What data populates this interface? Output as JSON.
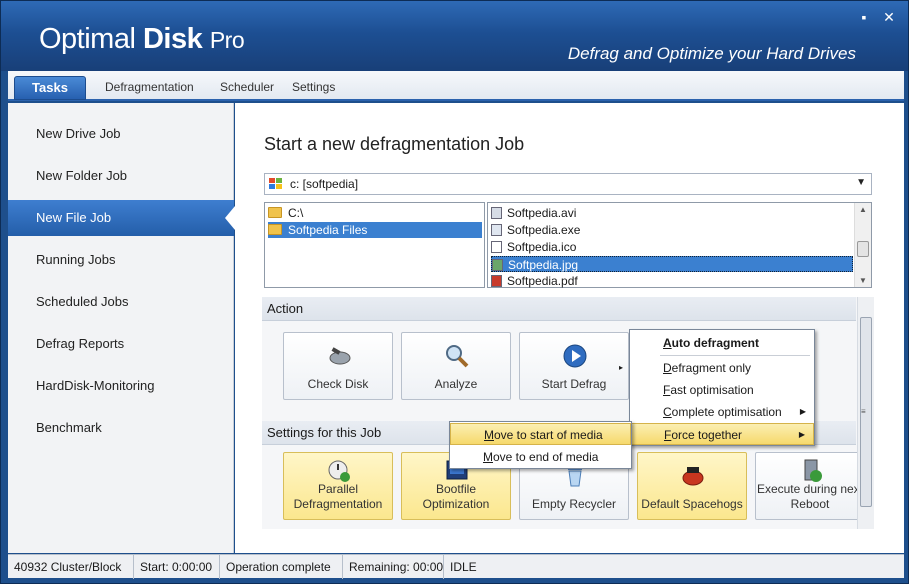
{
  "window": {
    "title_light": "Optimal",
    "title_bold": "Disk",
    "title_suffix": "Pro",
    "tagline": "Defrag and Optimize your Hard Drives",
    "minimize_glyph": "▪",
    "close_glyph": "✕"
  },
  "tabs": [
    {
      "label": "Tasks",
      "active": true
    },
    {
      "label": "Defragmentation"
    },
    {
      "label": "Scheduler"
    },
    {
      "label": "Settings"
    }
  ],
  "sidebar": {
    "items": [
      {
        "label": "New Drive Job"
      },
      {
        "label": "New Folder Job"
      },
      {
        "label": "New File Job",
        "active": true
      },
      {
        "label": "Running Jobs"
      },
      {
        "label": "Scheduled Jobs"
      },
      {
        "label": "Defrag Reports"
      },
      {
        "label": "HardDisk-Monitoring"
      },
      {
        "label": "Benchmark"
      }
    ]
  },
  "main": {
    "title": "Start a new defragmentation Job",
    "drive": {
      "value": "c: [softpedia]",
      "icon": "windows-drive-icon"
    },
    "folders": [
      {
        "label": "C:\\"
      },
      {
        "label": "Softpedia Files",
        "selected": true
      }
    ],
    "files": [
      {
        "label": "Softpedia.avi",
        "icon": "video-file-icon"
      },
      {
        "label": "Softpedia.exe",
        "icon": "exe-file-icon"
      },
      {
        "label": "Softpedia.ico",
        "icon": "ico-file-icon"
      },
      {
        "label": "Softpedia.jpg",
        "icon": "image-file-icon",
        "selected": true
      },
      {
        "label": "Softpedia.pdf",
        "icon": "pdf-file-icon"
      }
    ],
    "action_header": "Action",
    "actions": [
      {
        "label": "Check Disk",
        "icon": "check-disk-icon"
      },
      {
        "label": "Analyze",
        "icon": "magnifier-icon"
      },
      {
        "label": "Start Defrag",
        "icon": "play-icon"
      }
    ],
    "settings_header": "Settings for this Job",
    "settings": [
      {
        "label": "Parallel Defragmentation",
        "icon": "parallel-icon",
        "on": true
      },
      {
        "label": "Bootfile Optimization",
        "icon": "boot-icon",
        "on": true
      },
      {
        "label": "Empty Recycler",
        "icon": "recycle-bin-icon",
        "on": false
      },
      {
        "label": "Default Spacehogs",
        "icon": "spacehog-icon",
        "on": true
      },
      {
        "label": "Execute during next Reboot",
        "icon": "reboot-icon",
        "on": false
      }
    ]
  },
  "defrag_menu": {
    "items": [
      {
        "label": "Auto defragment",
        "ul": "A",
        "rest": "uto defragment",
        "bold": true
      },
      {
        "label": "Defragment only",
        "ul": "D",
        "rest": "efragment only"
      },
      {
        "label": "Fast optimisation",
        "ul": "F",
        "rest": "ast optimisation"
      },
      {
        "label": "Complete optimisation",
        "ul": "C",
        "rest": "omplete optimisation",
        "submenu": true
      },
      {
        "label": "Force together",
        "ul": "F",
        "rest": "orce together",
        "submenu": true,
        "highlighted": true
      }
    ]
  },
  "force_menu": {
    "items": [
      {
        "label": "Move to start of media",
        "ul": "M",
        "rest": "ove to start of media",
        "highlighted": true
      },
      {
        "label": "Move to end of media",
        "ul": "M",
        "rest": "ove to end of media"
      }
    ]
  },
  "statusbar": {
    "cluster": "40932 Cluster/Block",
    "start": "Start: 0:00:00",
    "operation": "Operation complete",
    "remaining": "Remaining: 00:00",
    "state": "IDLE"
  },
  "colors": {
    "accent": "#2760b0",
    "title_bar": "#1d4f93",
    "highlight": "#f6d96c"
  }
}
